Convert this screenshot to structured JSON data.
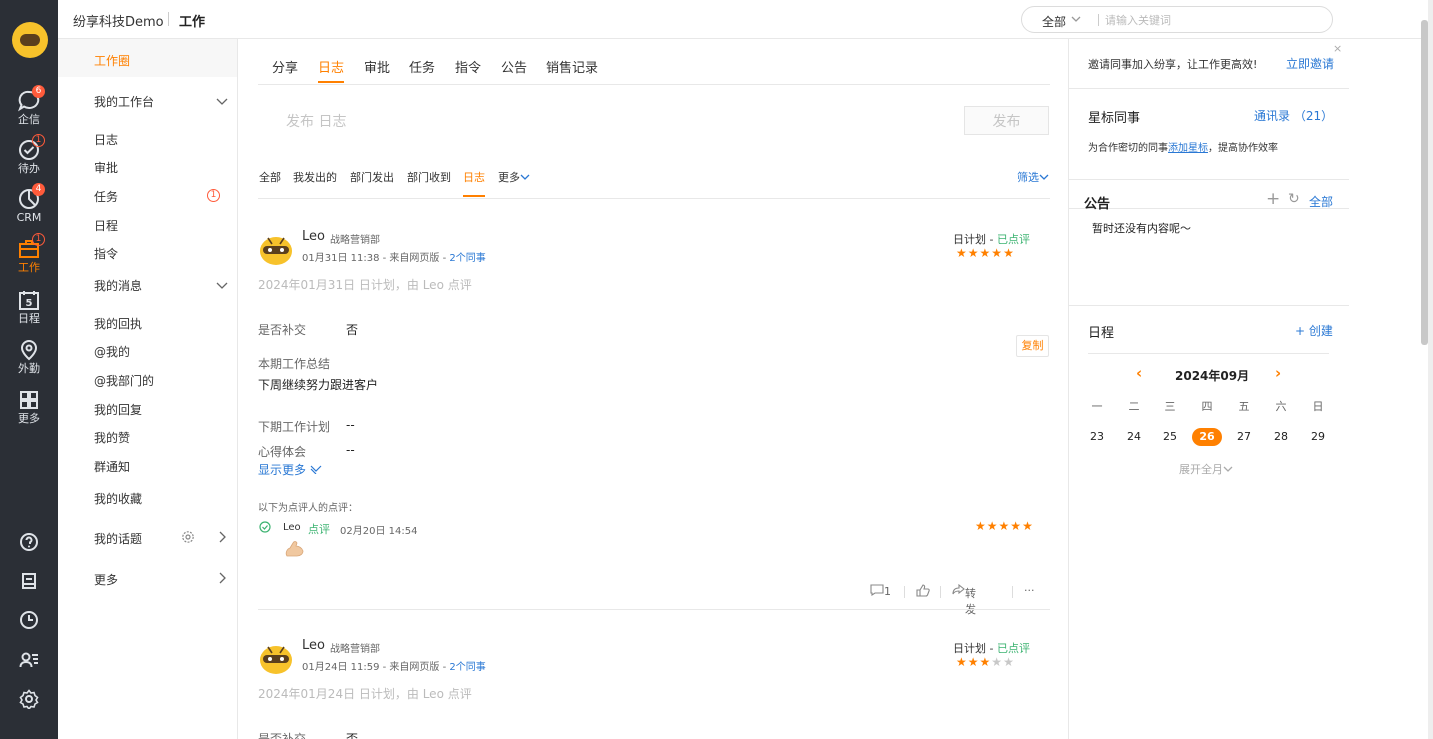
{
  "rail": {
    "items": [
      {
        "label": "企信",
        "badge": "6"
      },
      {
        "label": "待办",
        "badge": "1"
      },
      {
        "label": "CRM",
        "badge": "4"
      },
      {
        "label": "工作",
        "badge": "1"
      },
      {
        "label": "日程",
        "date": "5"
      },
      {
        "label": "外勤"
      },
      {
        "label": "更多"
      }
    ],
    "active_color": "#ff8000"
  },
  "topbar": {
    "company": "纷享科技Demo",
    "section": "工作",
    "search_scope": "全部",
    "search_placeholder": "请输入关键词"
  },
  "sidebar": {
    "home": "工作圈",
    "workbench": "我的工作台",
    "workbench_items": [
      "日志",
      "审批",
      "任务",
      "日程",
      "指令"
    ],
    "task_badge": "1",
    "messages": "我的消息",
    "message_items": [
      "我的回执",
      "@我的",
      "@我部门的",
      "我的回复",
      "我的赞",
      "群通知"
    ],
    "favorites": "我的收藏",
    "topics": "我的话题",
    "more": "更多"
  },
  "main": {
    "tabs": [
      "分享",
      "日志",
      "审批",
      "任务",
      "指令",
      "公告",
      "销售记录"
    ],
    "active_tab": "日志",
    "compose_placeholder": "发布 日志",
    "publish_label": "发布",
    "filters": [
      "全部",
      "我发出的",
      "部门发出",
      "部门收到",
      "日志"
    ],
    "more_filter": "更多",
    "screen_filter": "筛选",
    "posts": [
      {
        "author": "Leo",
        "dept": "战略营销部",
        "time": "01月31日 11:38",
        "source": " - 来自网页版 - ",
        "colleagues": "2个同事",
        "plan_type": "日计划",
        "plan_sep": " - ",
        "status": "已点评",
        "rating": 5,
        "subtitle": "2024年01月31日 日计划，由 Leo 点评",
        "resubmit_label": "是否补交",
        "resubmit_value": "否",
        "summary_label": "本期工作总结",
        "summary_value": "下周继续努力跟进客户",
        "copy_label": "复制",
        "next_plan_label": "下期工作计划",
        "next_plan_value": "--",
        "thoughts_label": "心得体会",
        "thoughts_value": "--",
        "show_more": "显示更多",
        "review_hint": "以下为点评人的点评：",
        "review": {
          "who": "Leo",
          "action": "点评",
          "time": "02月20日 14:54",
          "rating": 5
        },
        "comments_count": "1",
        "forward_label": "转发",
        "more_label": "···"
      },
      {
        "author": "Leo",
        "dept": "战略营销部",
        "time": "01月24日 11:59",
        "source": " - 来自网页版 - ",
        "colleagues": "2个同事",
        "plan_type": "日计划",
        "plan_sep": " - ",
        "status": "已点评",
        "rating": 3,
        "subtitle": "2024年01月24日 日计划，由 Leo 点评",
        "resubmit_label": "是否补交",
        "resubmit_value": "否"
      }
    ]
  },
  "right": {
    "invite_text": "邀请同事加入纷享，让工作更高效!",
    "invite_link": "立即邀请",
    "close": "×",
    "star_title": "星标同事",
    "contacts_label": "通讯录 （21）",
    "star_desc_prefix": "为合作密切的同事",
    "star_desc_link": "添加星标",
    "star_desc_suffix": "，提高协作效率",
    "notice_title": "公告",
    "notice_all": "全部",
    "notice_empty": "暂时还没有内容呢～",
    "calendar_title": "日程",
    "calendar_create": "+ 创建",
    "calendar_month": "2024年09月",
    "weekdays": [
      "一",
      "二",
      "三",
      "四",
      "五",
      "六",
      "日"
    ],
    "days": [
      "23",
      "24",
      "25",
      "26",
      "27",
      "28",
      "29"
    ],
    "today": "26",
    "expand_label": "展开全月"
  }
}
